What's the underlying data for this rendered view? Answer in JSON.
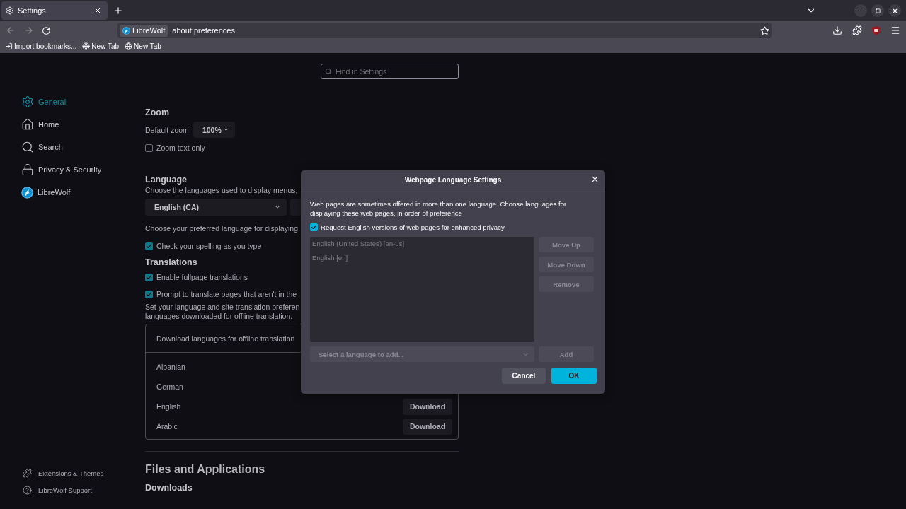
{
  "tabs": [
    {
      "title": "Settings",
      "selected": true
    }
  ],
  "address_bar": {
    "identity": "LibreWolf",
    "url": "about:preferences"
  },
  "bookmarks": [
    {
      "label": "Import bookmarks...",
      "kind": "import"
    },
    {
      "label": "New Tab",
      "kind": "page"
    },
    {
      "label": "New Tab",
      "kind": "page"
    }
  ],
  "search": {
    "placeholder": "Find in Settings"
  },
  "sidebar": {
    "items": [
      {
        "label": "General",
        "selected": true
      },
      {
        "label": "Home",
        "selected": false
      },
      {
        "label": "Search",
        "selected": false
      },
      {
        "label": "Privacy & Security",
        "selected": false
      },
      {
        "label": "LibreWolf",
        "selected": false
      }
    ],
    "footer": [
      {
        "label": "Extensions & Themes"
      },
      {
        "label": "LibreWolf Support"
      }
    ]
  },
  "zoom": {
    "heading": "Zoom",
    "label": "Default zoom",
    "value": "100%",
    "text_only": {
      "label": "Zoom text only",
      "checked": false
    }
  },
  "language": {
    "heading": "Language",
    "description": "Choose the languages used to display menus,",
    "select": "English (CA)",
    "preferred": "Choose your preferred language for displaying",
    "spelling": {
      "label": "Check your spelling as you type",
      "checked": true
    }
  },
  "translations": {
    "heading": "Translations",
    "options": [
      {
        "label": "Enable fullpage translations",
        "checked": true
      },
      {
        "label": "Prompt to translate pages that aren't in the",
        "checked": true
      }
    ],
    "description": [
      "Set your language and site translation preferen",
      "languages downloaded for offline translation."
    ],
    "download_header": "Download languages for offline translation",
    "languages": [
      {
        "name": "Albanian"
      },
      {
        "name": "German"
      },
      {
        "name": "English",
        "button": "Download"
      },
      {
        "name": "Arabic",
        "button": "Download"
      }
    ]
  },
  "files": {
    "heading": "Files and Applications",
    "subheading": "Downloads"
  },
  "dialog": {
    "title": "Webpage Language Settings",
    "description": "Web pages are sometimes offered in more than one language. Choose languages for displaying these web pages, in order of preference",
    "request_english": {
      "label": "Request English versions of web pages for enhanced privacy",
      "checked": true
    },
    "list": {
      "disabled": true,
      "items": [
        "English (United States) [en-us]",
        "English [en]"
      ]
    },
    "side_buttons": [
      {
        "label": "Move Up",
        "disabled": true
      },
      {
        "label": "Move Down",
        "disabled": true
      },
      {
        "label": "Remove",
        "disabled": true
      }
    ],
    "select": {
      "placeholder": "Select a language to add...",
      "disabled": true
    },
    "add": {
      "label": "Add",
      "disabled": true
    },
    "buttons": [
      {
        "label": "Cancel",
        "kind": "secondary"
      },
      {
        "label": "OK",
        "kind": "primary"
      }
    ]
  }
}
